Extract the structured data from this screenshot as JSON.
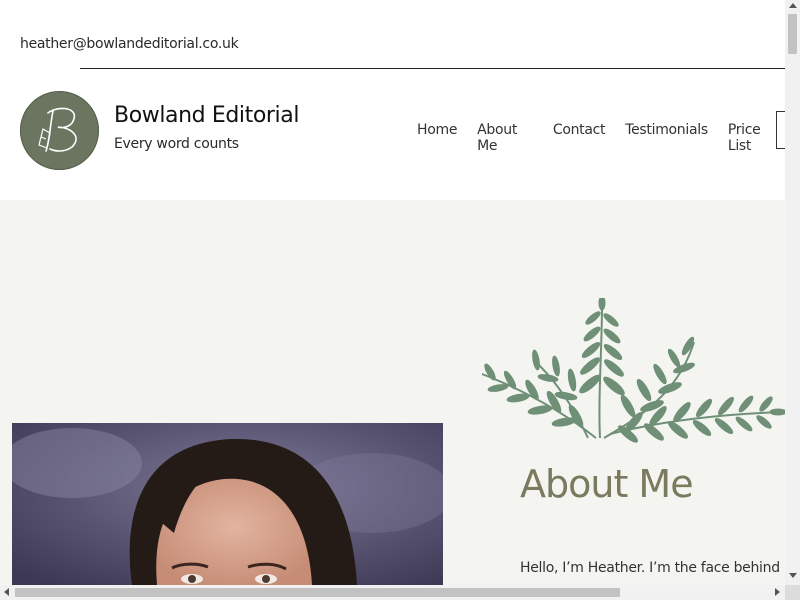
{
  "header": {
    "email": "heather@bowlandeditorial.co.uk",
    "site_title": "Bowland Editorial",
    "tagline": "Every word counts",
    "logo_icon": "bowland-b-logo-icon"
  },
  "nav": {
    "items": [
      {
        "label": "Home"
      },
      {
        "label": "About Me"
      },
      {
        "label": "Contact"
      },
      {
        "label": "Testimonials"
      },
      {
        "label": "Price List"
      }
    ]
  },
  "hero": {
    "decor_icon": "fern-leaves-icon",
    "photo_alt": "Portrait of Heather",
    "heading": "About Me",
    "intro": "Hello, I’m Heather. I’m the face behind Bo"
  },
  "colors": {
    "hero_bg": "#f4f5f1",
    "heading": "#7a7a5e",
    "fern": "#6f8f76",
    "logo_bg": "#6b7560"
  }
}
